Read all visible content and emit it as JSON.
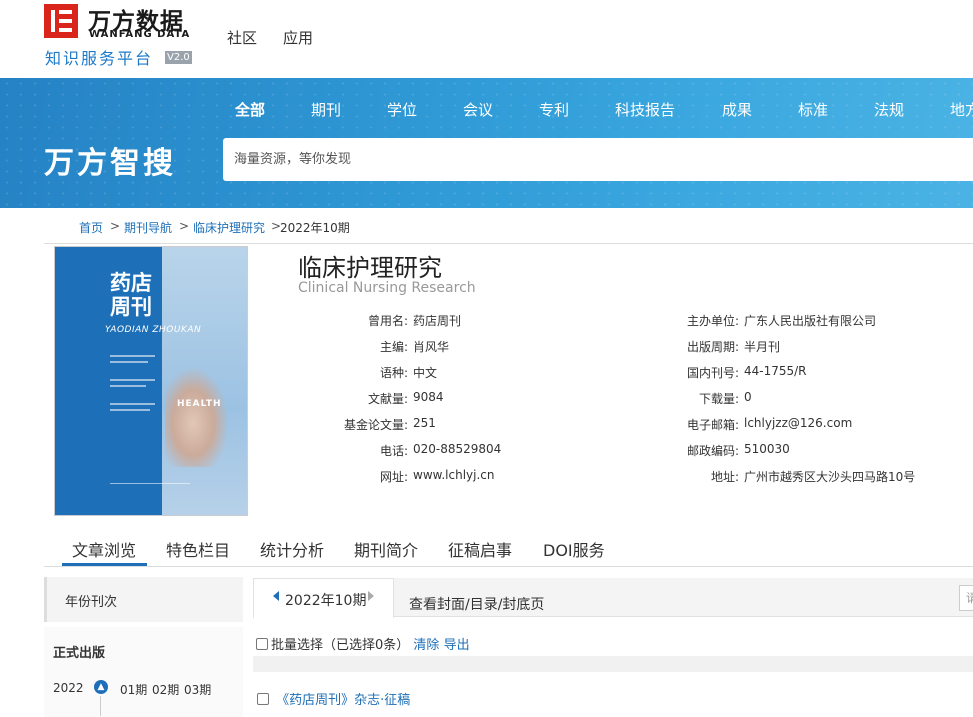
{
  "header": {
    "logo_cn": "万方数据",
    "logo_en": "WANFANG DATA",
    "platform": "知识服务平台",
    "version": "V2.0",
    "nav": [
      "社区",
      "应用"
    ]
  },
  "banner": {
    "categories": [
      "全部",
      "期刊",
      "学位",
      "会议",
      "专利",
      "科技报告",
      "成果",
      "标准",
      "法规",
      "地方"
    ],
    "active_category": "全部",
    "brand": "万方智搜",
    "search_placeholder": "海量资源，等你发现"
  },
  "breadcrumb": {
    "home": "首页",
    "journal_nav": "期刊导航",
    "journal": "临床护理研究",
    "current": "2022年10期",
    "sep": ">"
  },
  "journal": {
    "title": "临床护理研究",
    "title_en": "Clinical Nursing Research",
    "cover": {
      "title": "药店周刊",
      "pinyin": "YAODIAN ZHOUKAN",
      "health": "HEALTH"
    },
    "left_fields": [
      {
        "label": "曾用名:",
        "value": "药店周刊"
      },
      {
        "label": "主编:",
        "value": "肖风华"
      },
      {
        "label": "语种:",
        "value": "中文"
      },
      {
        "label": "文献量:",
        "value": "9084"
      },
      {
        "label": "基金论文量:",
        "value": "251"
      },
      {
        "label": "电话:",
        "value": "020-88529804"
      },
      {
        "label": "网址:",
        "value": "www.lchlyj.cn"
      }
    ],
    "right_fields": [
      {
        "label": "主办单位:",
        "value": "广东人民出版社有限公司"
      },
      {
        "label": "出版周期:",
        "value": "半月刊"
      },
      {
        "label": "国内刊号:",
        "value": "44-1755/R"
      },
      {
        "label": "下载量:",
        "value": "0"
      },
      {
        "label": "电子邮箱:",
        "value": "lchlyjzz@126.com"
      },
      {
        "label": "邮政编码:",
        "value": "510030"
      },
      {
        "label": "地址:",
        "value": "广州市越秀区大沙头四马路10号"
      }
    ]
  },
  "tabs": [
    "文章浏览",
    "特色栏目",
    "统计分析",
    "期刊简介",
    "征稿启事",
    "DOI服务"
  ],
  "active_tab": "文章浏览",
  "sidebar": {
    "heading": "年份刊次",
    "section": "正式出版",
    "year": "2022",
    "issues": [
      "01期",
      "02期",
      "03期"
    ]
  },
  "panel": {
    "current_issue": "2022年10期",
    "view_cover": "查看封面/目录/封底页",
    "mini_search_placeholder": "请",
    "batch_label": "批量选择（已选择0条）",
    "clear": "清除",
    "export": "导出",
    "articles": [
      "《药店周刊》杂志·征稿"
    ]
  },
  "colors": {
    "accent": "#1e6fb8",
    "brand_red": "#d9251c",
    "banner": "#2f9ad6"
  }
}
